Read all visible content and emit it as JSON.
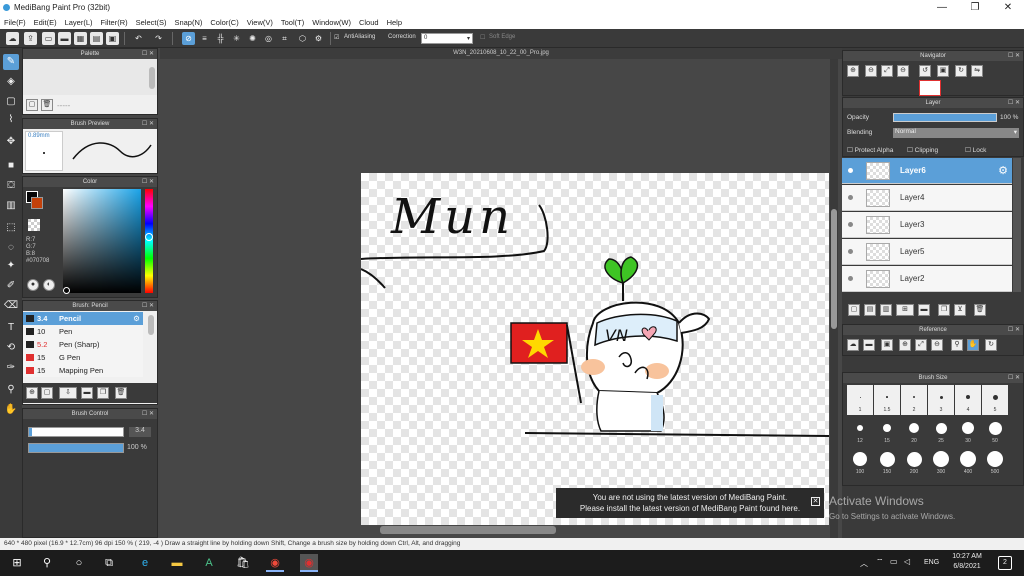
{
  "window": {
    "title": "MediBang Paint Pro (32bit)",
    "minimize": "—",
    "maximize": "❐",
    "close": "✕"
  },
  "menu": [
    "File(F)",
    "Edit(E)",
    "Layer(L)",
    "Filter(R)",
    "Select(S)",
    "Snap(N)",
    "Color(C)",
    "View(V)",
    "Tool(T)",
    "Window(W)",
    "Cloud",
    "Help"
  ],
  "toolbar": {
    "antialiasing": "AntiAliasing",
    "correction": "Correction",
    "correction_value": "0",
    "soft_edge": "Soft Edge"
  },
  "document": {
    "tab": "W3N_20210608_10_22_00_Pro.jpg",
    "handwriting": "Mun"
  },
  "palette": {
    "title": "Palette",
    "dashes": "-----"
  },
  "brush_preview": {
    "title": "Brush Preview",
    "size": "0.89mm"
  },
  "color": {
    "title": "Color",
    "r": "R:7",
    "g": "G:7",
    "b": "B:8",
    "hex": "#070708"
  },
  "brush_list": {
    "title": "Brush: Pencil",
    "items": [
      {
        "size": "3.4",
        "name": "Pencil",
        "color": "#222222"
      },
      {
        "size": "10",
        "name": "Pen",
        "color": "#222222"
      },
      {
        "size": "5.2",
        "name": "Pen (Sharp)",
        "color": "#222222"
      },
      {
        "size": "15",
        "name": "G Pen",
        "color": "#e03030"
      },
      {
        "size": "15",
        "name": "Mapping Pen",
        "color": "#e03030"
      }
    ]
  },
  "brush_control": {
    "title": "Brush Control",
    "size": "3.4",
    "opacity": "100 %"
  },
  "navigator": {
    "title": "Navigator"
  },
  "layer_panel": {
    "title": "Layer",
    "opacity_label": "Opacity",
    "opacity_value": "100 %",
    "blending_label": "Blending",
    "blending_value": "Normal",
    "protect_alpha": "Protect Alpha",
    "clipping": "Clipping",
    "lock": "Lock",
    "layers": [
      "Layer6",
      "Layer4",
      "Layer3",
      "Layer5",
      "Layer2"
    ]
  },
  "reference": {
    "title": "Reference"
  },
  "brush_size": {
    "title": "Brush Size",
    "labels": [
      "1",
      "1.5",
      "2",
      "3",
      "4",
      "5",
      "12",
      "15",
      "20",
      "25",
      "30",
      "50",
      "100",
      "150",
      "200",
      "300",
      "400",
      "500"
    ]
  },
  "notice": {
    "line1": "You are not using the latest version of MediBang Paint.",
    "line2": "Please install the latest version of MediBang Paint found here."
  },
  "activate": {
    "title": "Activate Windows",
    "subtitle": "Go to Settings to activate Windows."
  },
  "status": {
    "text": "640 * 480 pixel   (16.9 * 12.7cm)   96 dpi   150 %   ( 219, -4 )   Draw a straight line by holding down Shift, Change a brush size by holding down Ctrl, Alt, and dragging"
  },
  "taskbar": {
    "lang": "ENG",
    "time": "10:27 AM",
    "date": "6/8/2021",
    "notif": "2"
  },
  "colors": {
    "accent": "#5b9fd8",
    "flag_red": "#e0201f",
    "flag_star": "#ffd800",
    "leaf": "#3ec424"
  }
}
